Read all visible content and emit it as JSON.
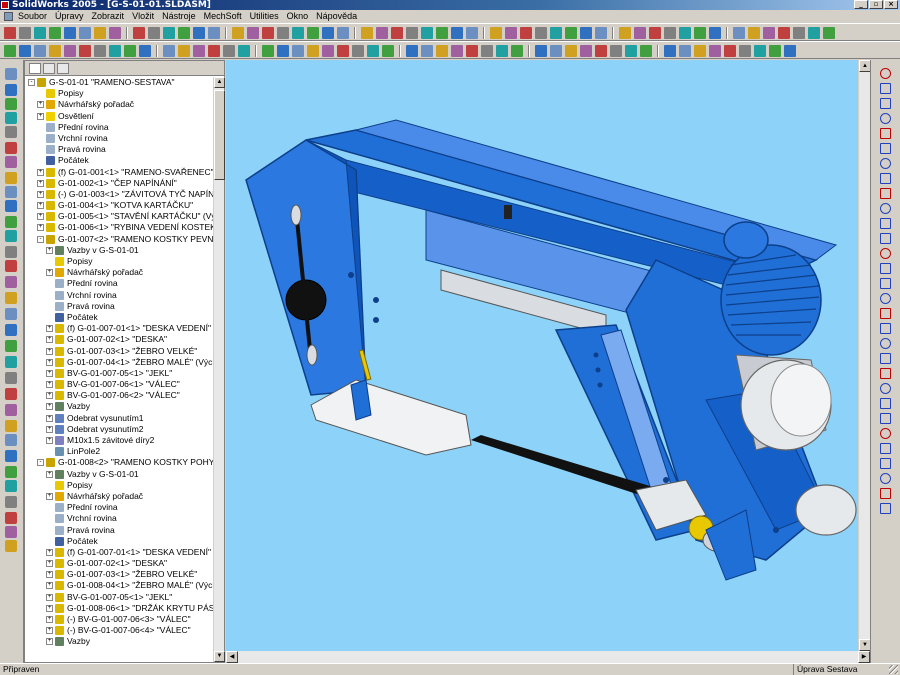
{
  "window": {
    "title": "SolidWorks 2005 - [G-S-01-01.SLDASM]",
    "controls": [
      "_",
      "▫",
      "×"
    ]
  },
  "menu": [
    "Soubor",
    "Úpravy",
    "Zobrazit",
    "Vložit",
    "Nástroje",
    "MechSoft",
    "Utilities",
    "Okno",
    "Nápověda"
  ],
  "colors": {
    "viewport_bg": "#8dd3f9",
    "part_blue": "#1f6fd6",
    "part_blue_dark": "#0d3f8a",
    "part_grey": "#d9dde2",
    "title_bar": "#0a246a",
    "toolbar_bg": "#d4d0c8"
  },
  "tree": {
    "items": [
      {
        "depth": 0,
        "exp": "-",
        "icon": "assembly",
        "label": "G-S-01-01 \"RAMENO-SESTAVA\""
      },
      {
        "depth": 1,
        "exp": "",
        "icon": "annotations",
        "label": "Popisy"
      },
      {
        "depth": 1,
        "exp": "+",
        "icon": "design-binder",
        "label": "Návrhářský pořadač"
      },
      {
        "depth": 1,
        "exp": "+",
        "icon": "lighting",
        "label": "Osvětlení"
      },
      {
        "depth": 1,
        "exp": "",
        "icon": "plane",
        "label": "Přední rovina"
      },
      {
        "depth": 1,
        "exp": "",
        "icon": "plane",
        "label": "Vrchní rovina"
      },
      {
        "depth": 1,
        "exp": "",
        "icon": "plane",
        "label": "Pravá rovina"
      },
      {
        "depth": 1,
        "exp": "",
        "icon": "origin",
        "label": "Počátek"
      },
      {
        "depth": 1,
        "exp": "+",
        "icon": "part",
        "label": "(f) G-01-001<1> \"RAMENO-SVAŘENEC\""
      },
      {
        "depth": 1,
        "exp": "+",
        "icon": "part",
        "label": "G-01-002<1> \"ČEP NAPÍNÁNÍ\""
      },
      {
        "depth": 1,
        "exp": "+",
        "icon": "part",
        "label": "(-) G-01-003<1> \"ZÁVITOVÁ TYČ NAPÍN.\""
      },
      {
        "depth": 1,
        "exp": "+",
        "icon": "part",
        "label": "G-01-004<1> \"KOTVA KARTÁČKU\""
      },
      {
        "depth": 1,
        "exp": "+",
        "icon": "part",
        "label": "G-01-005<1> \"STAVĚNÍ KARTÁČKU\" (Výchozí)"
      },
      {
        "depth": 1,
        "exp": "+",
        "icon": "part",
        "label": "G-01-006<1> \"RYBINA VEDENÍ KOSTEK\""
      },
      {
        "depth": 1,
        "exp": "-",
        "icon": "subassembly",
        "label": "G-01-007<2> \"RAMENO KOSTKY PEVNÉ\""
      },
      {
        "depth": 2,
        "exp": "+",
        "icon": "mates",
        "label": "Vazby v G-S-01-01"
      },
      {
        "depth": 2,
        "exp": "",
        "icon": "annotations",
        "label": "Popisy"
      },
      {
        "depth": 2,
        "exp": "+",
        "icon": "design-binder",
        "label": "Návrhářský pořadač"
      },
      {
        "depth": 2,
        "exp": "",
        "icon": "plane",
        "label": "Přední rovina"
      },
      {
        "depth": 2,
        "exp": "",
        "icon": "plane",
        "label": "Vrchní rovina"
      },
      {
        "depth": 2,
        "exp": "",
        "icon": "plane",
        "label": "Pravá rovina"
      },
      {
        "depth": 2,
        "exp": "",
        "icon": "origin",
        "label": "Počátek"
      },
      {
        "depth": 2,
        "exp": "+",
        "icon": "part",
        "label": "(f) G-01-007-01<1> \"DESKA VEDENÍ\""
      },
      {
        "depth": 2,
        "exp": "+",
        "icon": "part",
        "label": "G-01-007-02<1> \"DESKA\""
      },
      {
        "depth": 2,
        "exp": "+",
        "icon": "part",
        "label": "G-01-007-03<1> \"ŽEBRO VELKÉ\""
      },
      {
        "depth": 2,
        "exp": "+",
        "icon": "part",
        "label": "G-01-007-04<1> \"ŽEBRO MALÉ\" (Výchozí)"
      },
      {
        "depth": 2,
        "exp": "+",
        "icon": "part",
        "label": "BV-G-01-007-05<1> \"JEKL\""
      },
      {
        "depth": 2,
        "exp": "+",
        "icon": "part",
        "label": "BV-G-01-007-06<1> \"VÁLEC\""
      },
      {
        "depth": 2,
        "exp": "+",
        "icon": "part",
        "label": "BV-G-01-007-06<2> \"VÁLEC\""
      },
      {
        "depth": 2,
        "exp": "+",
        "icon": "mates",
        "label": "Vazby"
      },
      {
        "depth": 2,
        "exp": "+",
        "icon": "cut",
        "label": "Odebrat vysunutím1"
      },
      {
        "depth": 2,
        "exp": "+",
        "icon": "cut",
        "label": "Odebrat vysunutím2"
      },
      {
        "depth": 2,
        "exp": "+",
        "icon": "hole",
        "label": "M10x1.5 závitové díry2"
      },
      {
        "depth": 2,
        "exp": "",
        "icon": "pattern",
        "label": "LinPole2"
      },
      {
        "depth": 1,
        "exp": "-",
        "icon": "subassembly",
        "label": "G-01-008<2> \"RAMENO KOSTKY POHYBL.\""
      },
      {
        "depth": 2,
        "exp": "+",
        "icon": "mates",
        "label": "Vazby v G-S-01-01"
      },
      {
        "depth": 2,
        "exp": "",
        "icon": "annotations",
        "label": "Popisy"
      },
      {
        "depth": 2,
        "exp": "+",
        "icon": "design-binder",
        "label": "Návrhářský pořadač"
      },
      {
        "depth": 2,
        "exp": "",
        "icon": "plane",
        "label": "Přední rovina"
      },
      {
        "depth": 2,
        "exp": "",
        "icon": "plane",
        "label": "Vrchní rovina"
      },
      {
        "depth": 2,
        "exp": "",
        "icon": "plane",
        "label": "Pravá rovina"
      },
      {
        "depth": 2,
        "exp": "",
        "icon": "origin",
        "label": "Počátek"
      },
      {
        "depth": 2,
        "exp": "+",
        "icon": "part",
        "label": "(f) G-01-007-01<1> \"DESKA VEDENÍ\""
      },
      {
        "depth": 2,
        "exp": "+",
        "icon": "part",
        "label": "G-01-007-02<1> \"DESKA\""
      },
      {
        "depth": 2,
        "exp": "+",
        "icon": "part",
        "label": "G-01-007-03<1> \"ŽEBRO VELKÉ\""
      },
      {
        "depth": 2,
        "exp": "+",
        "icon": "part",
        "label": "G-01-008-04<1> \"ŽEBRO MALÉ\" (Výchozí)"
      },
      {
        "depth": 2,
        "exp": "+",
        "icon": "part",
        "label": "BV-G-01-007-05<1> \"JEKL\""
      },
      {
        "depth": 2,
        "exp": "+",
        "icon": "part",
        "label": "G-01-008-06<1> \"DRŽÁK KRYTU PÁSU\""
      },
      {
        "depth": 2,
        "exp": "+",
        "icon": "part",
        "label": "(-) BV-G-01-007-06<3> \"VÁLEC\""
      },
      {
        "depth": 2,
        "exp": "+",
        "icon": "part",
        "label": "(-) BV-G-01-007-06<4> \"VÁLEC\""
      },
      {
        "depth": 2,
        "exp": "+",
        "icon": "mates",
        "label": "Vazby"
      }
    ]
  },
  "status": {
    "left": "Připraven",
    "right": "Úprava Sestava"
  }
}
